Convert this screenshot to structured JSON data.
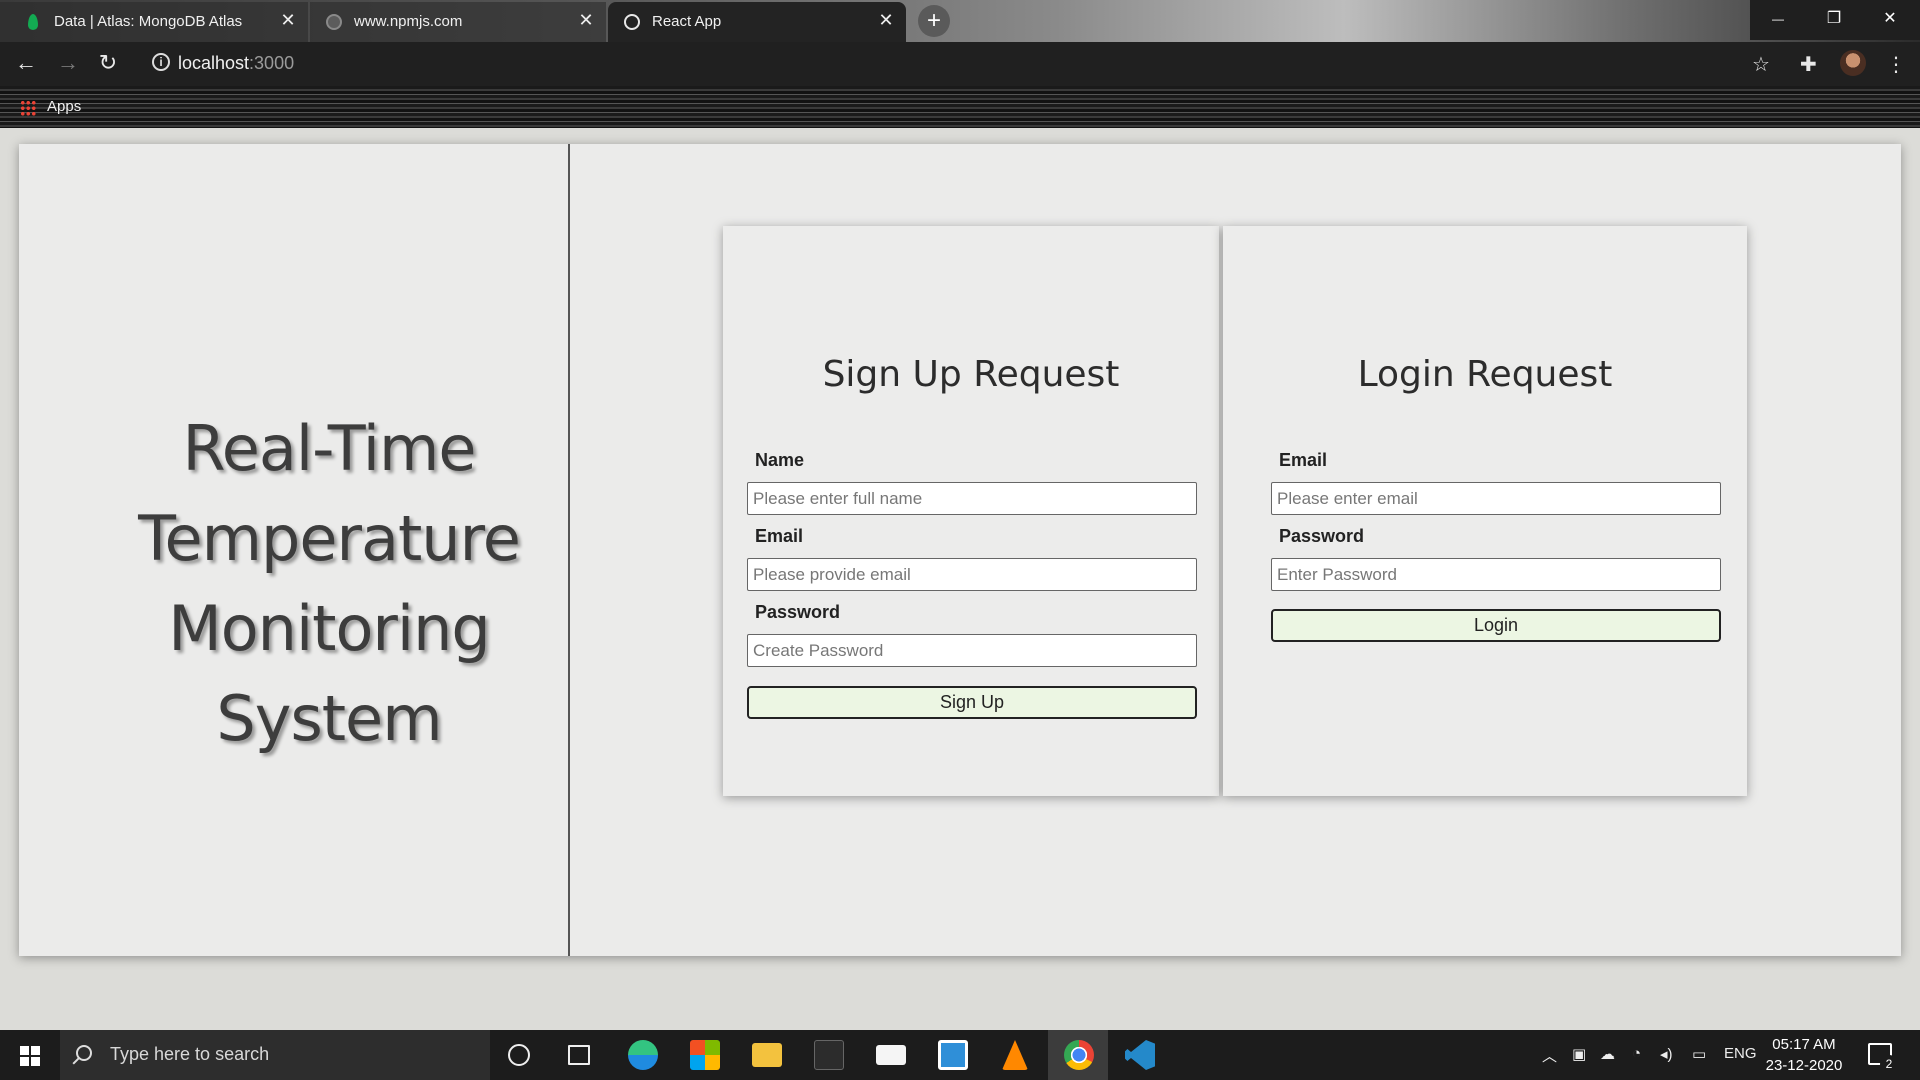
{
  "browser": {
    "tabs": [
      {
        "title": "Data | Atlas: MongoDB Atlas",
        "close": "✕"
      },
      {
        "title": "www.npmjs.com",
        "close": "✕"
      },
      {
        "title": "React App",
        "close": "✕"
      }
    ],
    "new_tab": "+",
    "url_host": "localhost",
    "url_port": ":3000",
    "bookmarks": {
      "apps_label": "Apps"
    },
    "window_controls": {
      "minimize": "—",
      "restore": "❐",
      "close": "✕"
    }
  },
  "app": {
    "hero_lines": [
      "Real-Time",
      "Temperature",
      "Monitoring",
      "System"
    ],
    "signup": {
      "title": "Sign Up Request",
      "name_label": "Name",
      "name_placeholder": "Please enter full name",
      "email_label": "Email",
      "email_placeholder": "Please provide email",
      "password_label": "Password",
      "password_placeholder": "Create Password",
      "submit_label": "Sign Up"
    },
    "login": {
      "title": "Login Request",
      "email_label": "Email",
      "email_placeholder": "Please enter email",
      "password_label": "Password",
      "password_placeholder": "Enter Password",
      "submit_label": "Login"
    }
  },
  "taskbar": {
    "search_placeholder": "Type here to search",
    "language": "ENG",
    "time": "05:17 AM",
    "date": "23-12-2020",
    "notification_count": "2"
  }
}
